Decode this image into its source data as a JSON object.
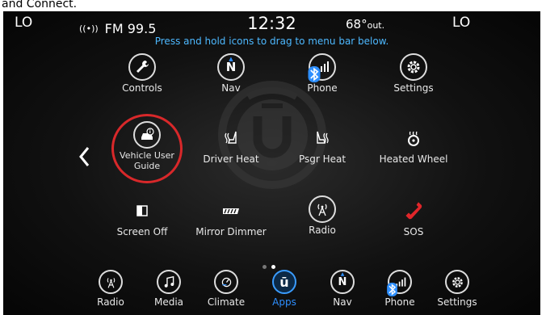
{
  "caption": "and Connect.",
  "status": {
    "left_temp": "LO",
    "right_temp": "LO",
    "radio": "FM 99.5",
    "time": "12:32",
    "outside_temp": "68°",
    "outside_suffix": "out."
  },
  "hint": "Press and hold icons to drag to menu bar below.",
  "apps": [
    {
      "label": "Controls",
      "icon": "wrench-icon"
    },
    {
      "label": "Nav",
      "icon": "compass-n-icon",
      "glyph": "N"
    },
    {
      "label": "Phone",
      "icon": "phone-signal-icon"
    },
    {
      "label": "Settings",
      "icon": "gear-icon"
    },
    {
      "label": "Vehicle User Guide",
      "line1": "Vehicle User",
      "line2": "Guide",
      "icon": "car-info-icon"
    },
    {
      "label": "Driver Heat",
      "icon": "heated-seat-icon"
    },
    {
      "label": "Psgr Heat",
      "icon": "heated-seat-icon"
    },
    {
      "label": "Heated Wheel",
      "icon": "heated-wheel-icon"
    },
    {
      "label": "Screen Off",
      "icon": "screen-off-icon"
    },
    {
      "label": "Mirror Dimmer",
      "icon": "mirror-dimmer-icon"
    },
    {
      "label": "Radio",
      "icon": "radio-tower-icon"
    },
    {
      "label": "SOS",
      "icon": "phone-handset-icon"
    }
  ],
  "pager": {
    "pages": 2,
    "current": 2
  },
  "bottom_bar": [
    {
      "label": "Radio",
      "icon": "radio-tower-icon"
    },
    {
      "label": "Media",
      "icon": "music-note-icon"
    },
    {
      "label": "Climate",
      "icon": "climate-icon"
    },
    {
      "label": "Apps",
      "icon": "uconnect-icon",
      "glyph": "ū",
      "active": true
    },
    {
      "label": "Nav",
      "icon": "compass-n-icon",
      "glyph": "N"
    },
    {
      "label": "Phone",
      "icon": "phone-signal-icon"
    },
    {
      "label": "Settings",
      "icon": "gear-icon"
    }
  ],
  "colors": {
    "accent": "#2e8fff",
    "hint": "#4db8ff",
    "highlight": "#d8282a",
    "sos": "#e0262a"
  }
}
